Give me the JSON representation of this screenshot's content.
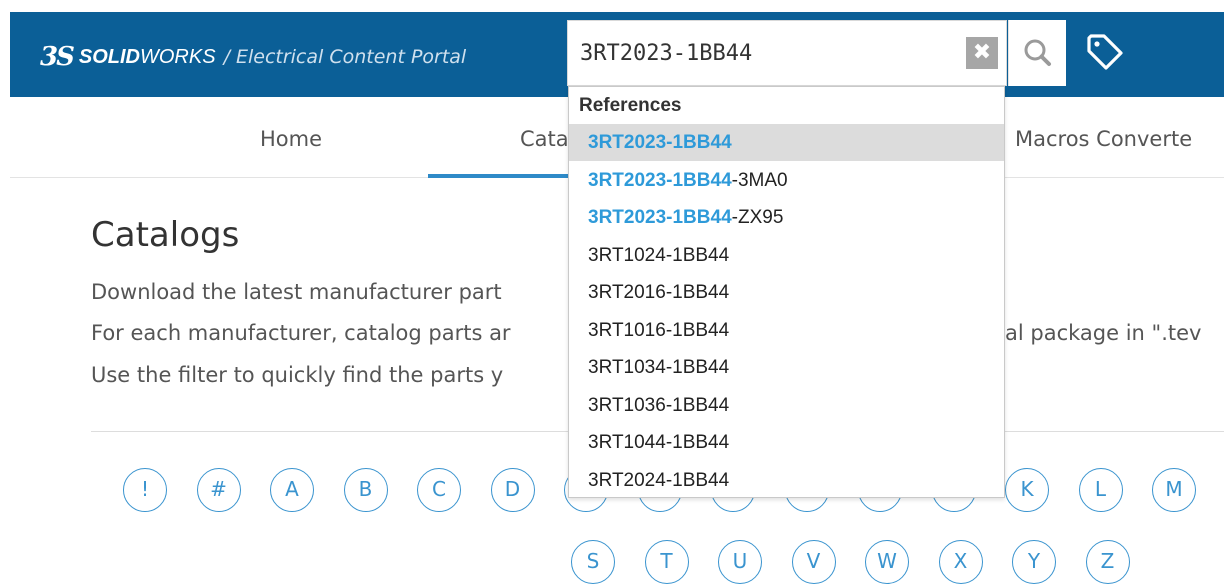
{
  "header": {
    "logo_ds": "3S",
    "brand_bold": "SOLID",
    "brand_rest": "WORKS",
    "separator": "/",
    "portal_name": "Electrical Content Portal"
  },
  "search": {
    "value": "3RT2023-1BB44",
    "placeholder": "",
    "clear_label": "✖"
  },
  "nav": {
    "home": "Home",
    "catalogs": "Cata",
    "macros": "Macros Converte"
  },
  "main": {
    "title": "Catalogs",
    "desc_1": "Download the latest manufacturer part",
    "desc_2": "For each manufacturer, catalog parts ar",
    "desc_2_tail": "al package in \".tev",
    "desc_3": "Use the filter to quickly find the parts y"
  },
  "letters_row_1": [
    "!",
    "#",
    "A",
    "B",
    "C",
    "D",
    "",
    "",
    "",
    "",
    "",
    "",
    "K",
    "L",
    "M"
  ],
  "letters_row_2": [
    "S",
    "T",
    "U",
    "V",
    "W",
    "X",
    "Y",
    "Z"
  ],
  "dropdown": {
    "header": "References",
    "items": [
      {
        "match": "3RT2023-1BB44",
        "rest": "",
        "selected": true
      },
      {
        "match": "3RT2023-1BB44",
        "rest": "-3MA0",
        "selected": false
      },
      {
        "match": "3RT2023-1BB44",
        "rest": "-ZX95",
        "selected": false
      },
      {
        "match": "",
        "rest": "3RT1024-1BB44",
        "selected": false
      },
      {
        "match": "",
        "rest": "3RT2016-1BB44",
        "selected": false
      },
      {
        "match": "",
        "rest": "3RT1016-1BB44",
        "selected": false
      },
      {
        "match": "",
        "rest": "3RT1034-1BB44",
        "selected": false
      },
      {
        "match": "",
        "rest": "3RT1036-1BB44",
        "selected": false
      },
      {
        "match": "",
        "rest": "3RT1044-1BB44",
        "selected": false
      },
      {
        "match": "",
        "rest": "3RT2024-1BB44",
        "selected": false
      }
    ]
  },
  "colors": {
    "header_bg": "#0b5f97",
    "accent": "#3a94cf",
    "match_highlight": "#2e9ad9"
  },
  "icons": {
    "search": "search-icon",
    "tag": "tag-icon",
    "clear": "clear-icon"
  }
}
